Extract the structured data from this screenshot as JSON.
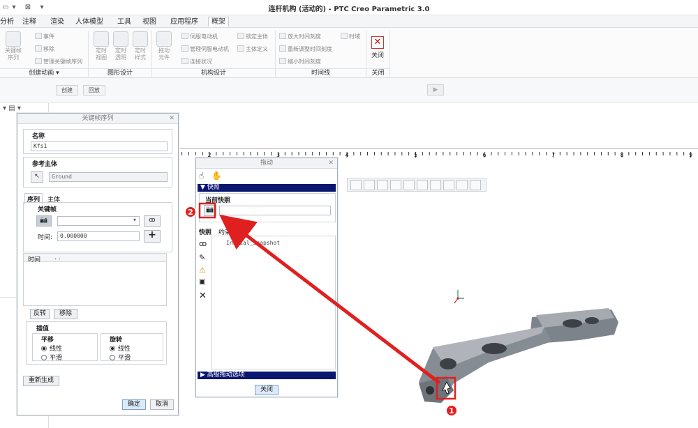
{
  "window": {
    "title": "连杆机构 (活动的) - PTC Creo Parametric 3.0"
  },
  "menu": {
    "tabs": [
      "分析",
      "注释",
      "渲染",
      "人体模型",
      "工具",
      "视图",
      "应用程序",
      "概架"
    ],
    "active_index": 7
  },
  "ribbon": {
    "big_buttons": [
      {
        "label": "关键帧序列"
      },
      {
        "label": "定时视图"
      },
      {
        "label": "定时透明"
      },
      {
        "label": "定时样式"
      },
      {
        "label": "拖动元件"
      }
    ],
    "create_anim_small": [
      "事件",
      "移除",
      "管理关键帧序列"
    ],
    "mech_small": [
      "伺服电动机",
      "管理伺服电动机",
      "连接状况"
    ],
    "mech_small2": [
      "锁定主体",
      "主体定义"
    ],
    "timeline_small": [
      "放大时间刻度",
      "重新调整时间刻度",
      "缩小时间刻度"
    ],
    "timeline_extra": "时域",
    "close_label": "关闭",
    "groups": [
      "创建动画 ▾",
      "图形设计",
      "机构设计",
      "时间线",
      "关闭"
    ]
  },
  "toolbar2": {
    "create": "创建",
    "rollback": "回放"
  },
  "ruler": {
    "ticks": [
      "2",
      "3",
      "4",
      "5",
      "6",
      "7",
      "8",
      "9"
    ]
  },
  "keyframe_dialog": {
    "title": "关键帧序列",
    "name_label": "名称",
    "name_value": "Kfs1",
    "ref_body_label": "参考主体",
    "ref_body_value": "Ground",
    "tabs": [
      "序列",
      "主体"
    ],
    "keyframe_label": "关键帧",
    "time_label": "时间:",
    "time_value": "0.000000",
    "list_header": [
      "时间",
      ". ."
    ],
    "reverse": "反转",
    "remove": "移除",
    "interp_label": "插值",
    "translate_label": "平移",
    "rotate_label": "旋转",
    "linear": "线性",
    "smooth": "平滑",
    "regenerate": "重新生成",
    "ok": "确定",
    "cancel": "取消"
  },
  "drag_dialog": {
    "title": "拖动",
    "snapshot_header": "快照",
    "current_snapshot": "当前快照",
    "tabs": [
      "快照",
      "约束"
    ],
    "snapshot_item": "Initial_Snapshot",
    "advanced": "高级拖动选项",
    "close": "关闭"
  },
  "callouts": {
    "one": "1",
    "two": "2"
  },
  "colors": {
    "accent_red": "#e0201f",
    "navy": "#0b1670",
    "part_gray": "#8a8f96"
  }
}
